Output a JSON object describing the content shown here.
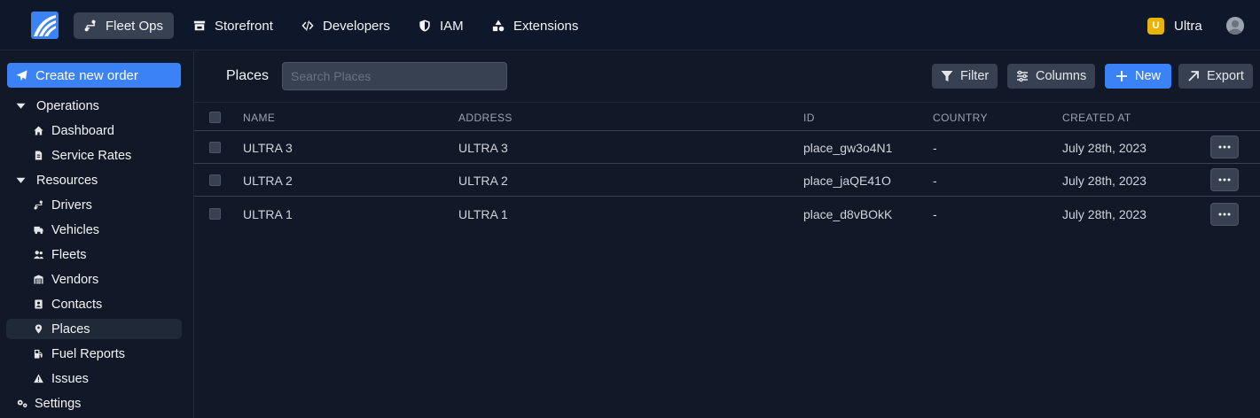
{
  "nav": {
    "items": [
      {
        "label": "Fleet Ops",
        "icon": "route-icon",
        "active": true
      },
      {
        "label": "Storefront",
        "icon": "store-icon"
      },
      {
        "label": "Developers",
        "icon": "code-icon"
      },
      {
        "label": "IAM",
        "icon": "shield-icon"
      },
      {
        "label": "Extensions",
        "icon": "shapes-icon"
      }
    ],
    "org": {
      "badge": "U",
      "name": "Ultra"
    }
  },
  "sidebar": {
    "create_label": "Create new order",
    "sections": [
      {
        "label": "Operations",
        "items": [
          "Dashboard",
          "Service Rates"
        ]
      },
      {
        "label": "Resources",
        "items": [
          "Drivers",
          "Vehicles",
          "Fleets",
          "Vendors",
          "Contacts",
          "Places",
          "Fuel Reports",
          "Issues"
        ]
      },
      {
        "label": "Settings"
      }
    ],
    "active_item": "Places"
  },
  "toolbar": {
    "title": "Places",
    "search_placeholder": "Search Places",
    "filter_label": "Filter",
    "columns_label": "Columns",
    "new_label": "New",
    "export_label": "Export"
  },
  "table": {
    "columns": [
      "NAME",
      "ADDRESS",
      "ID",
      "COUNTRY",
      "CREATED AT"
    ],
    "rows": [
      {
        "name": "ULTRA 3",
        "address": "ULTRA 3",
        "id": "place_gw3o4N1",
        "country": "-",
        "created_at": "July 28th, 2023"
      },
      {
        "name": "ULTRA 2",
        "address": "ULTRA 2",
        "id": "place_jaQE41O",
        "country": "-",
        "created_at": "July 28th, 2023"
      },
      {
        "name": "ULTRA 1",
        "address": "ULTRA 1",
        "id": "place_d8vBOkK",
        "country": "-",
        "created_at": "July 28th, 2023"
      }
    ]
  },
  "colors": {
    "accent": "#3b82f6",
    "background": "#111827",
    "badge": "#eab308"
  }
}
